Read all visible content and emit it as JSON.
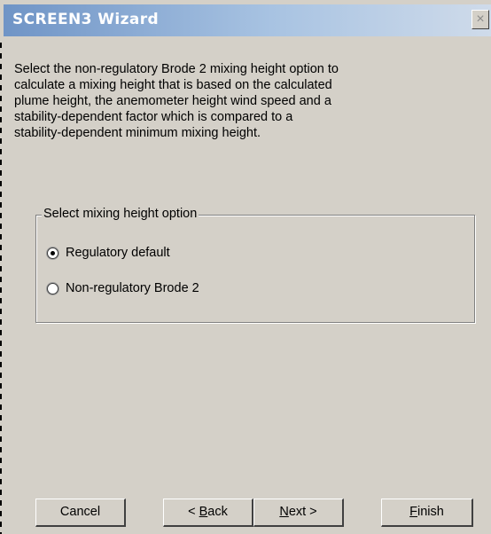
{
  "window": {
    "title": "SCREEN3 Wizard",
    "close_glyph": "×"
  },
  "instruction": {
    "line1": "Select the non-regulatory Brode 2 mixing height option to",
    "line2": "calculate a mixing height that is based on the calculated",
    "line3": "plume height, the anemometer height wind speed and a",
    "line4": "stability-dependent factor which is compared to a",
    "line5": "stability-dependent minimum mixing height."
  },
  "mixing_height_group": {
    "label": "Select mixing height option",
    "options": [
      {
        "label": "Regulatory default",
        "selected": true
      },
      {
        "label": "Non-regulatory Brode 2",
        "selected": false
      }
    ]
  },
  "buttons": {
    "cancel": "Cancel",
    "back_prefix": "< ",
    "back_mnemonic": "B",
    "back_rest": "ack",
    "next_mnemonic": "N",
    "next_rest": "ext >",
    "finish_mnemonic": "F",
    "finish_rest": "inish"
  }
}
